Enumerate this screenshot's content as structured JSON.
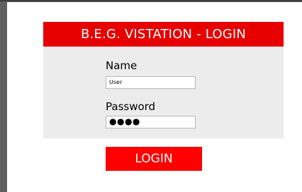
{
  "header": {
    "title": "B.E.G. VISTATION - LOGIN"
  },
  "form": {
    "name_label": "Name",
    "name_value": "User",
    "password_label": "Password",
    "password_mask": "●●●●"
  },
  "actions": {
    "login_label": "LOGIN"
  },
  "colors": {
    "accent": "#e60000",
    "button": "#ff0000",
    "panel": "#ececec",
    "frame": "#5f5f5f"
  }
}
